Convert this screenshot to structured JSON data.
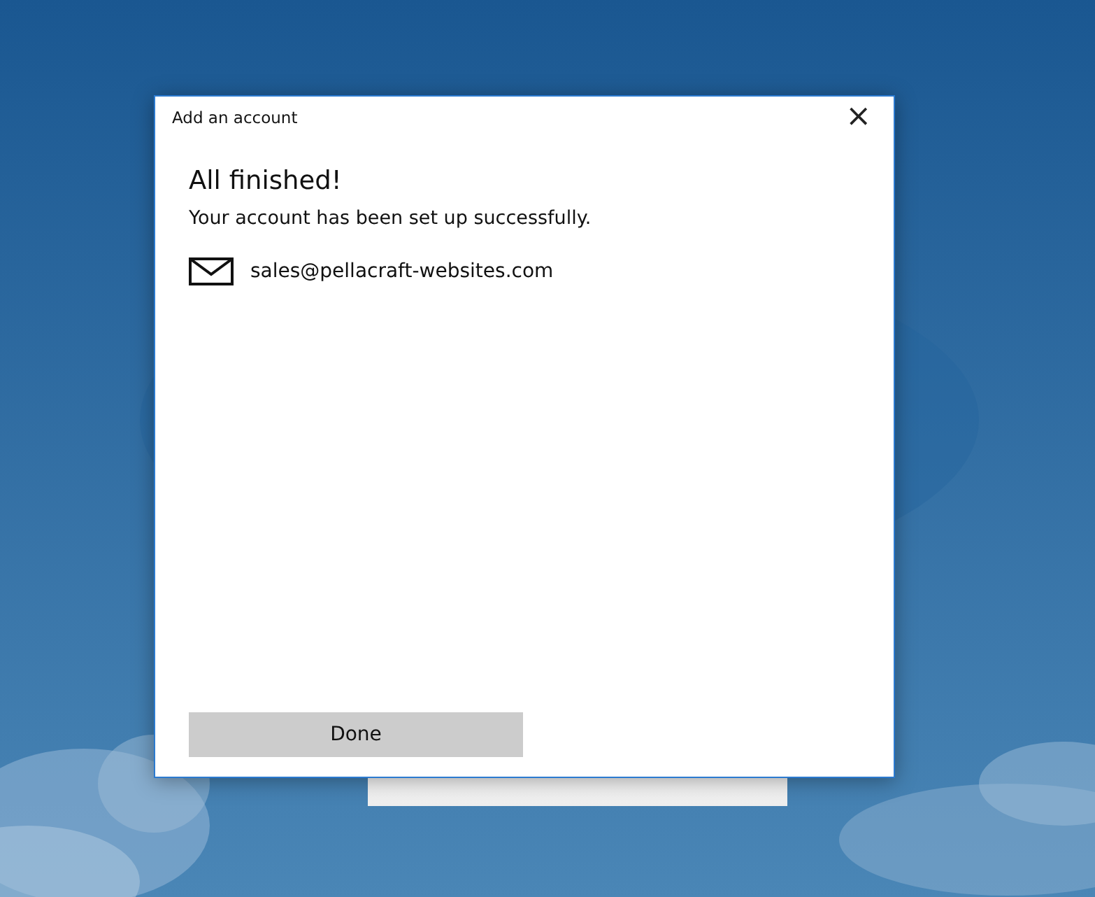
{
  "dialog": {
    "title": "Add an account",
    "close": "×",
    "heading": "All finished!",
    "message": "Your account has been set up successfully.",
    "account": "sales@pellacraft-websites.com",
    "button": "Done"
  }
}
